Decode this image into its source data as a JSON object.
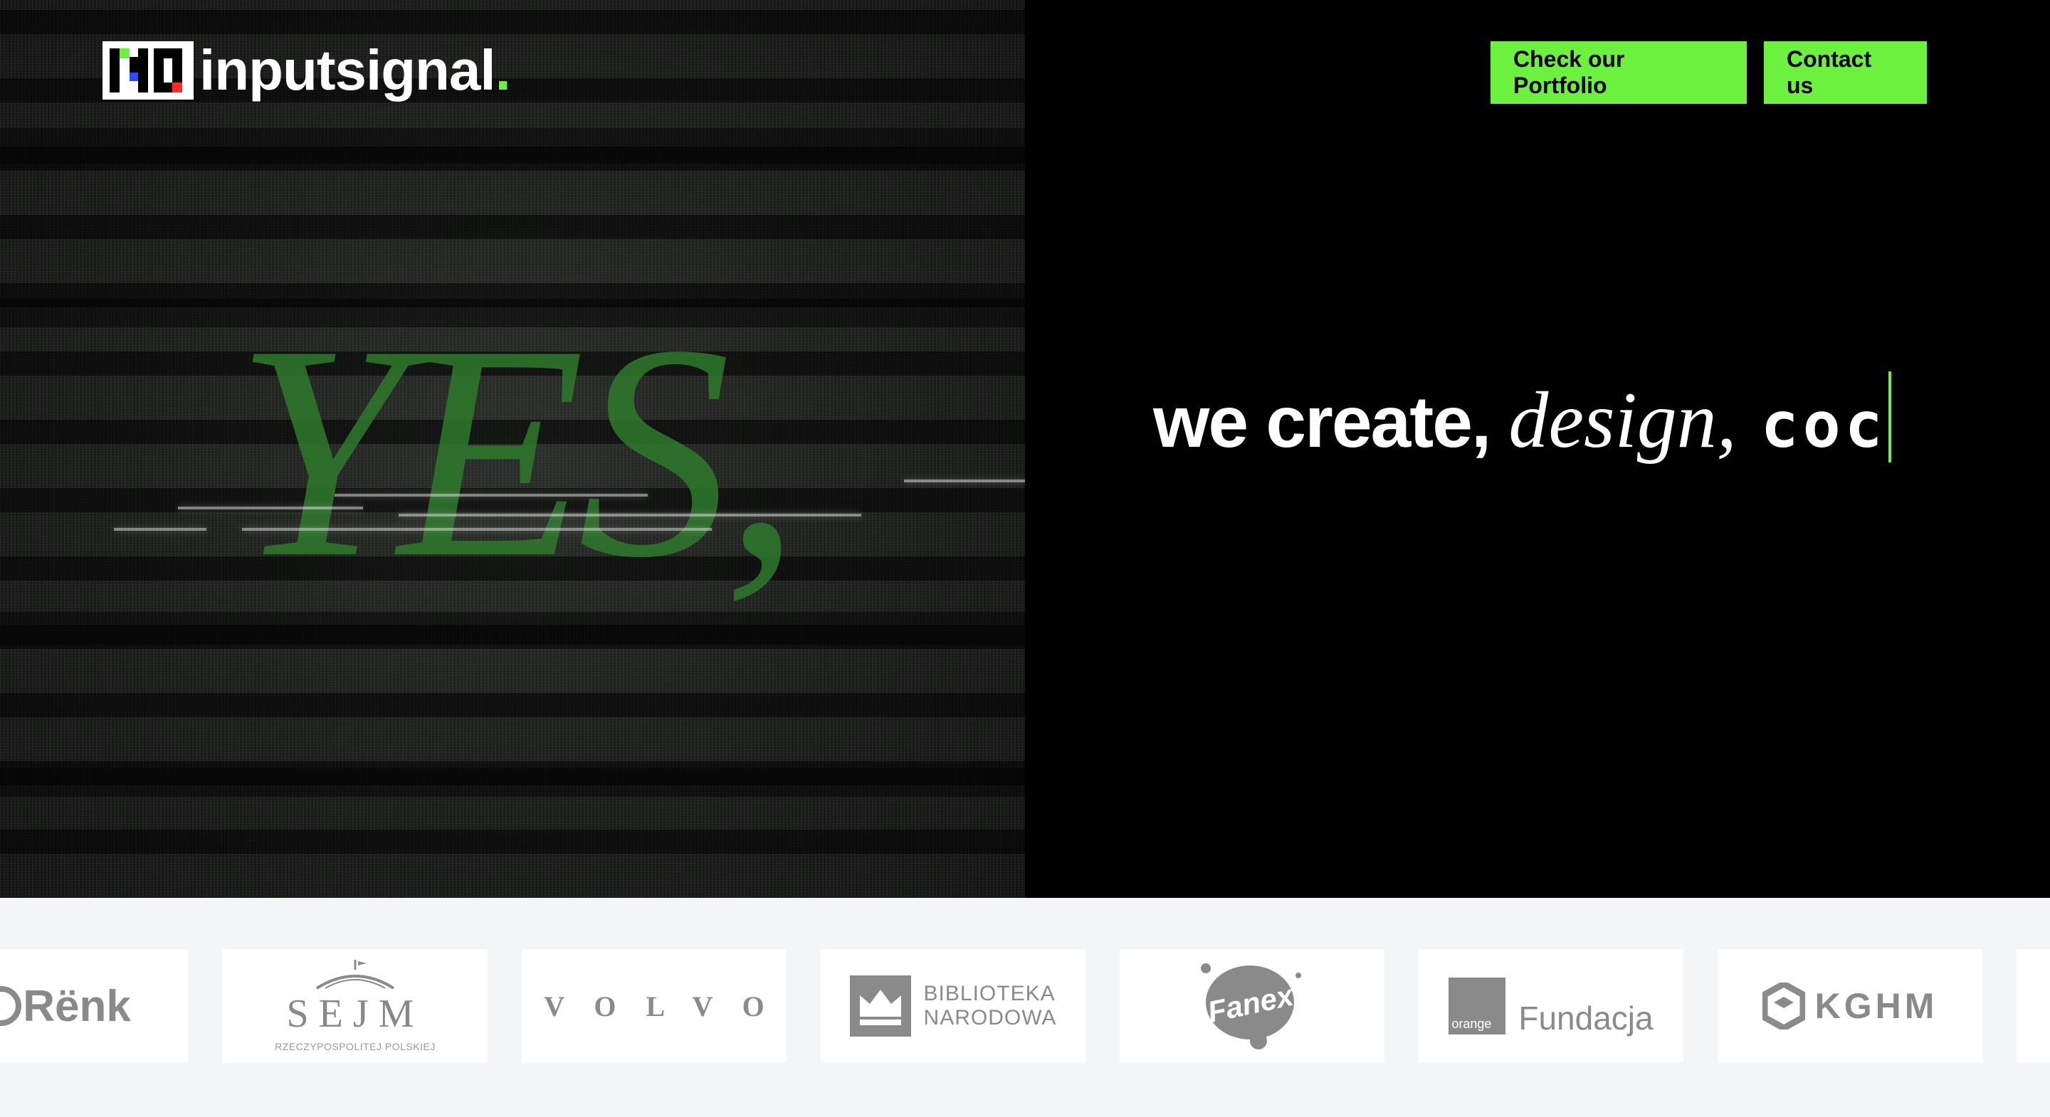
{
  "header": {
    "logo_text": "inputsignal",
    "logo_dot": ".",
    "nav": {
      "portfolio_label": "Check our Portfolio",
      "contact_label": "Contact us"
    }
  },
  "hero": {
    "video_word": "YES,",
    "headline": {
      "part1": "we create,",
      "part2": "design,",
      "part3_typing": "coc"
    }
  },
  "clients": {
    "logos": [
      {
        "name": "Rënk",
        "text": "Rënk"
      },
      {
        "name": "Sejm",
        "text": "SEJM",
        "subtext": "RZECZYPOSPOLITEJ POLSKIEJ"
      },
      {
        "name": "Volvo",
        "text": "VOLVO"
      },
      {
        "name": "Biblioteka Narodowa",
        "line1": "BIBLIOTEKA",
        "line2": "NARODOWA"
      },
      {
        "name": "Fanex",
        "text": "Fanex"
      },
      {
        "name": "Orange Fundacja",
        "badge": "orange",
        "text": "Fundacja"
      },
      {
        "name": "KGHM",
        "text": "KGHM"
      }
    ]
  },
  "colors": {
    "accent": "#6cf13e",
    "background": "#000000",
    "strip_background": "#f4f5f7",
    "logo_gray": "#8a8a8a"
  }
}
